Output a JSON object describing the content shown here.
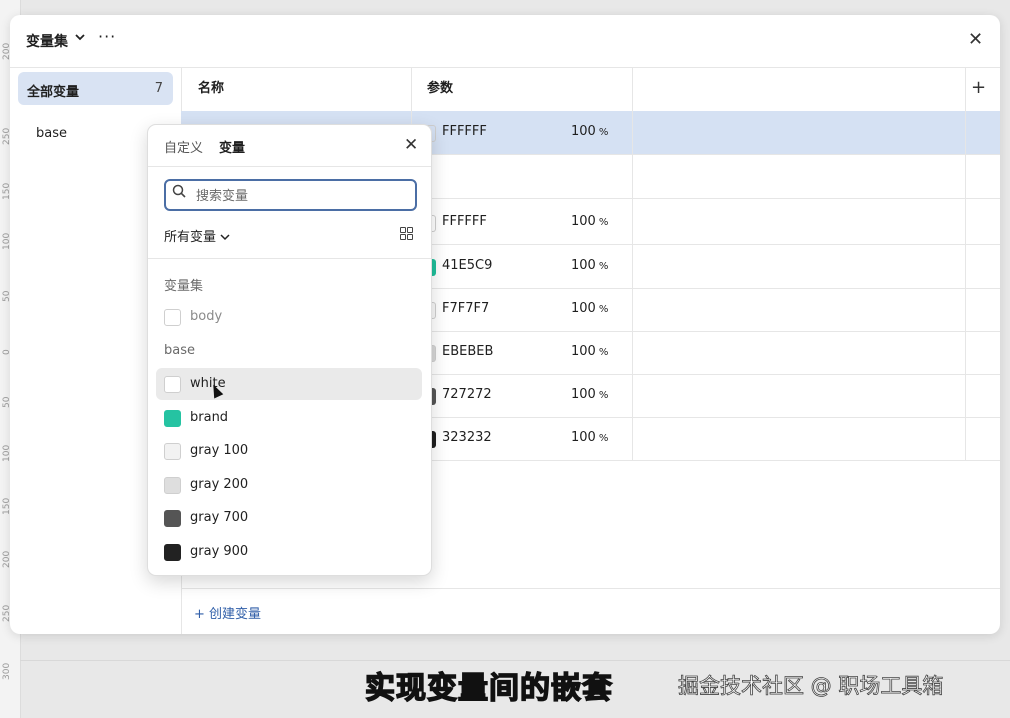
{
  "ruler": {
    "ticks": [
      "200",
      "250",
      "150",
      "100",
      "50",
      "0",
      "50",
      "100",
      "150",
      "200",
      "250",
      "300"
    ]
  },
  "panel": {
    "title": "变量集",
    "more": "···",
    "close": "✕"
  },
  "sidebar": {
    "all_label": "全部变量",
    "all_count": "7",
    "group": "base"
  },
  "table": {
    "col_name": "名称",
    "col_param": "参数",
    "add": "+",
    "rows": [
      {
        "hex": "FFFFFF",
        "pct": "100",
        "unit": "%",
        "color": "#ffffff",
        "selected": true
      },
      {
        "hex": "FFFFFF",
        "pct": "100",
        "unit": "%",
        "color": "#ffffff"
      },
      {
        "hex": "41E5C9",
        "pct": "100",
        "unit": "%",
        "color": "#1fbf9b"
      },
      {
        "hex": "F7F7F7",
        "pct": "100",
        "unit": "%",
        "color": "#f7f7f7"
      },
      {
        "hex": "EBEBEB",
        "pct": "100",
        "unit": "%",
        "color": "#d8d8d8"
      },
      {
        "hex": "727272",
        "pct": "100",
        "unit": "%",
        "color": "#555555"
      },
      {
        "hex": "323232",
        "pct": "100",
        "unit": "%",
        "color": "#1e1e1e"
      }
    ],
    "create_label": "+ 创建变量"
  },
  "popover": {
    "tab_custom": "自定义",
    "tab_variable": "变量",
    "close": "✕",
    "search_placeholder": "搜索变量",
    "filter_label": "所有变量",
    "group_collection": "变量集",
    "collection_items": [
      {
        "name": "body",
        "color": "#ffffff"
      }
    ],
    "group_base": "base",
    "base_items": [
      {
        "name": "white",
        "color": "#ffffff"
      },
      {
        "name": "brand",
        "color": "#25c3a2"
      },
      {
        "name": "gray 100",
        "color": "#f2f2f2"
      },
      {
        "name": "gray 200",
        "color": "#dedede"
      },
      {
        "name": "gray 700",
        "color": "#555555"
      },
      {
        "name": "gray 900",
        "color": "#222222"
      }
    ]
  },
  "caption": "实现变量间的嵌套",
  "watermark": "掘金技术社区 @ 职场工具箱"
}
